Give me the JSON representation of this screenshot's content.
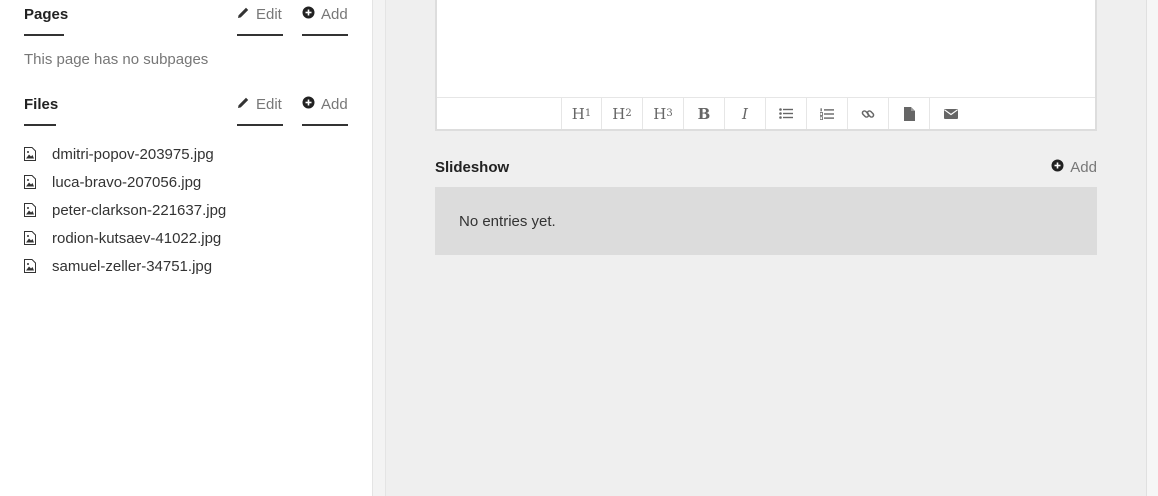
{
  "sidebar": {
    "pages": {
      "title": "Pages",
      "edit_label": "Edit",
      "add_label": "Add",
      "empty_text": "This page has no subpages"
    },
    "files": {
      "title": "Files",
      "edit_label": "Edit",
      "add_label": "Add",
      "items": [
        {
          "name": "dmitri-popov-203975.jpg",
          "icon": "image-file-icon"
        },
        {
          "name": "luca-bravo-207056.jpg",
          "icon": "image-file-icon"
        },
        {
          "name": "peter-clarkson-221637.jpg",
          "icon": "image-file-icon"
        },
        {
          "name": "rodion-kutsaev-41022.jpg",
          "icon": "image-file-icon"
        },
        {
          "name": "samuel-zeller-34751.jpg",
          "icon": "image-file-icon"
        }
      ]
    }
  },
  "editor": {
    "toolbar": [
      {
        "label": "H",
        "sub": "1",
        "icon": "heading-1-icon"
      },
      {
        "label": "H",
        "sub": "2",
        "icon": "heading-2-icon"
      },
      {
        "label": "H",
        "sub": "3",
        "icon": "heading-3-icon"
      },
      {
        "label": "B",
        "icon": "bold-icon"
      },
      {
        "label": "I",
        "icon": "italic-icon"
      },
      {
        "icon": "bullet-list-icon"
      },
      {
        "icon": "numbered-list-icon"
      },
      {
        "icon": "link-icon"
      },
      {
        "icon": "file-icon"
      },
      {
        "icon": "email-icon"
      }
    ]
  },
  "slideshow": {
    "title": "Slideshow",
    "add_label": "Add",
    "empty_text": "No entries yet."
  },
  "colors": {
    "panel_bg": "#efefef",
    "empty_box_bg": "#dcdcdc",
    "muted_text": "#777777"
  }
}
